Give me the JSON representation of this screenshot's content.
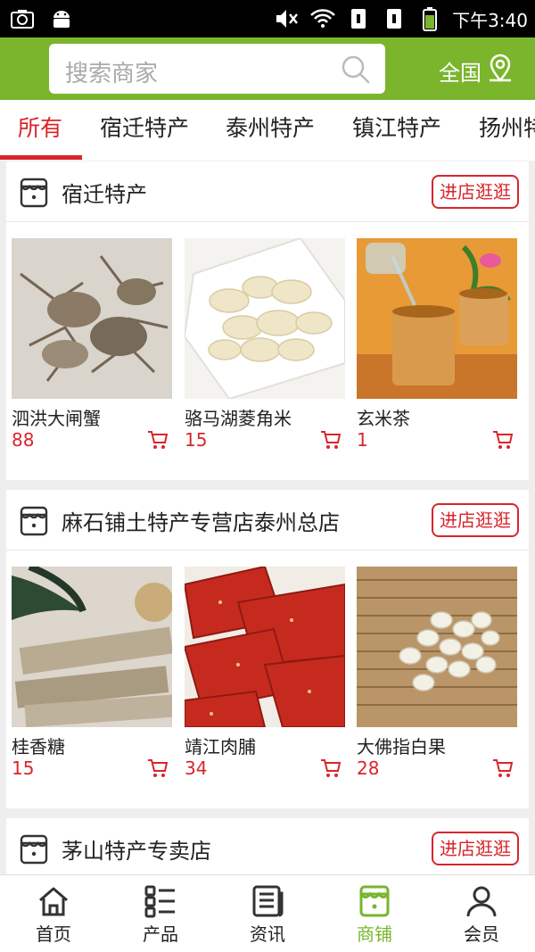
{
  "status_bar": {
    "time": "下午3:40"
  },
  "header": {
    "search_placeholder": "搜索商家",
    "region_label": "全国"
  },
  "tabs": [
    {
      "label": "所有",
      "active": true
    },
    {
      "label": "宿迁特产"
    },
    {
      "label": "泰州特产"
    },
    {
      "label": "镇江特产"
    },
    {
      "label": "扬州特"
    }
  ],
  "stores": [
    {
      "name": "宿迁特产",
      "visit_label": "进店逛逛",
      "products": [
        {
          "name": "泗洪大闸蟹",
          "price": "88"
        },
        {
          "name": "骆马湖菱角米",
          "price": "15"
        },
        {
          "name": "玄米茶",
          "price": "1"
        }
      ]
    },
    {
      "name": "麻石铺土特产专营店泰州总店",
      "visit_label": "进店逛逛",
      "products": [
        {
          "name": "桂香糖",
          "price": "15"
        },
        {
          "name": "靖江肉脯",
          "price": "34"
        },
        {
          "name": "大佛指白果",
          "price": "28"
        }
      ]
    },
    {
      "name": "茅山特产专卖店",
      "visit_label": "进店逛逛",
      "products": []
    }
  ],
  "bottom_nav": [
    {
      "label": "首页",
      "icon": "home-icon"
    },
    {
      "label": "产品",
      "icon": "list-icon"
    },
    {
      "label": "资讯",
      "icon": "news-icon"
    },
    {
      "label": "商铺",
      "icon": "shop-icon",
      "active": true
    },
    {
      "label": "会员",
      "icon": "user-icon"
    }
  ],
  "colors": {
    "brand_green": "#7ab52c",
    "accent_red": "#d8252b"
  }
}
